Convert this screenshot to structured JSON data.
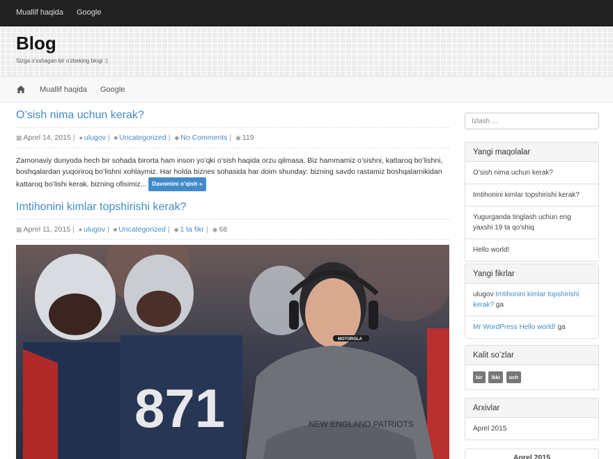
{
  "topnav": {
    "items": [
      "Muallif haqida",
      "Google"
    ]
  },
  "site": {
    "title": "Blog",
    "tagline": "Sizga o'xshagan bir o'zbeking blogi :)"
  },
  "mainnav": {
    "home_icon": "home-icon",
    "items": [
      "Muallif haqida",
      "Google"
    ]
  },
  "posts": [
    {
      "title": "O’sish nima uchun kerak?",
      "date": "Aprel 14, 2015",
      "author": "ulugov",
      "category": "Uncategorized",
      "comments": "No Comments",
      "views": "119",
      "excerpt": "Zamonaviy dunyoda hech bir sohada birorta ham inson yo’qki o’sish haqida orzu qilmasa. Biz hammamiz o’sishni, kattaroq bo’lishni, boshqalardan yuqoriroq bo’lishni xohlaymiz. Har holda biznes sohasida har doim shunday: bizning savdo rastamiz boshqalarnikidan kattaroq bo’lishi kerak, bizning ofisimiz...",
      "more_label": "Davomini o'qish »"
    },
    {
      "title": "Imtihonini kimlar topshirishi kerak?",
      "date": "Aprel 11, 2015",
      "author": "ulugov",
      "category": "Uncategorized",
      "comments": "1 ta fikr",
      "views": "68"
    }
  ],
  "sidebar": {
    "search_placeholder": "Izlash ...",
    "recent_posts": {
      "title": "Yangi maqolalar",
      "items": [
        "O’sish nima uchun kerak?",
        "Imtihonini kimlar topshirishi kerak?",
        "Yugurganda tinglash uchun eng yaxshi 19 ta qo’shiq",
        "Hello world!"
      ]
    },
    "recent_comments": {
      "title": "Yangi fikrlar",
      "items": [
        {
          "author": "ulugov",
          "post": "Imtihonini kimlar topshirishi kerak?",
          "suffix": "ga"
        },
        {
          "author": "Mr WordPress",
          "post": "Hello world!",
          "suffix": "ga"
        }
      ]
    },
    "tags": {
      "title": "Kalit so’zlar",
      "items": [
        "bir",
        "ikki",
        "uch"
      ]
    },
    "archives": {
      "title": "Arxivlar",
      "items": [
        "Aprel 2015"
      ]
    },
    "calendar": {
      "month": "Aprel 2015"
    }
  },
  "colors": {
    "accent": "#428bca",
    "topbar": "#222222",
    "button": "#428bca",
    "tag": "#777777"
  }
}
